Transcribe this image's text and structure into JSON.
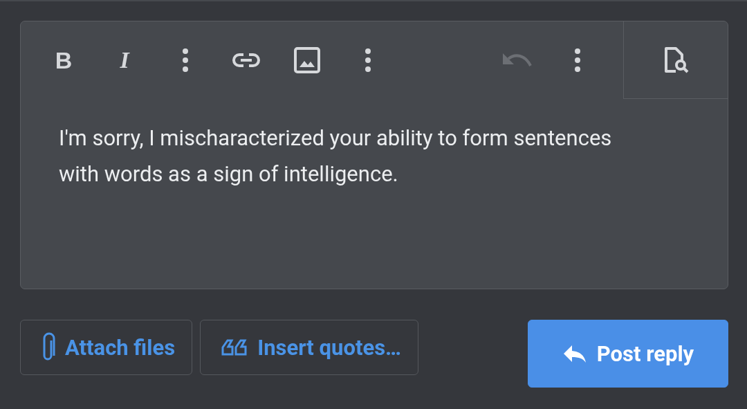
{
  "editor": {
    "toolbar": [
      {
        "kind": "bold",
        "label": "B",
        "disabled": false
      },
      {
        "kind": "italic",
        "label": "I",
        "disabled": false
      },
      {
        "kind": "more",
        "disabled": false
      },
      {
        "kind": "link",
        "disabled": false
      },
      {
        "kind": "image",
        "disabled": false
      },
      {
        "kind": "more",
        "disabled": false
      },
      {
        "kind": "spacer"
      },
      {
        "kind": "undo",
        "disabled": true
      },
      {
        "kind": "more",
        "disabled": false
      }
    ],
    "value": "I'm sorry, I mischaracterized your ability to form sentences with words as a sign of intelligence."
  },
  "actions": [
    {
      "kind": "attach",
      "label": "Attach files"
    },
    {
      "kind": "quote",
      "label": "Insert quotes…"
    },
    {
      "kind": "post",
      "label": "Post reply"
    }
  ]
}
